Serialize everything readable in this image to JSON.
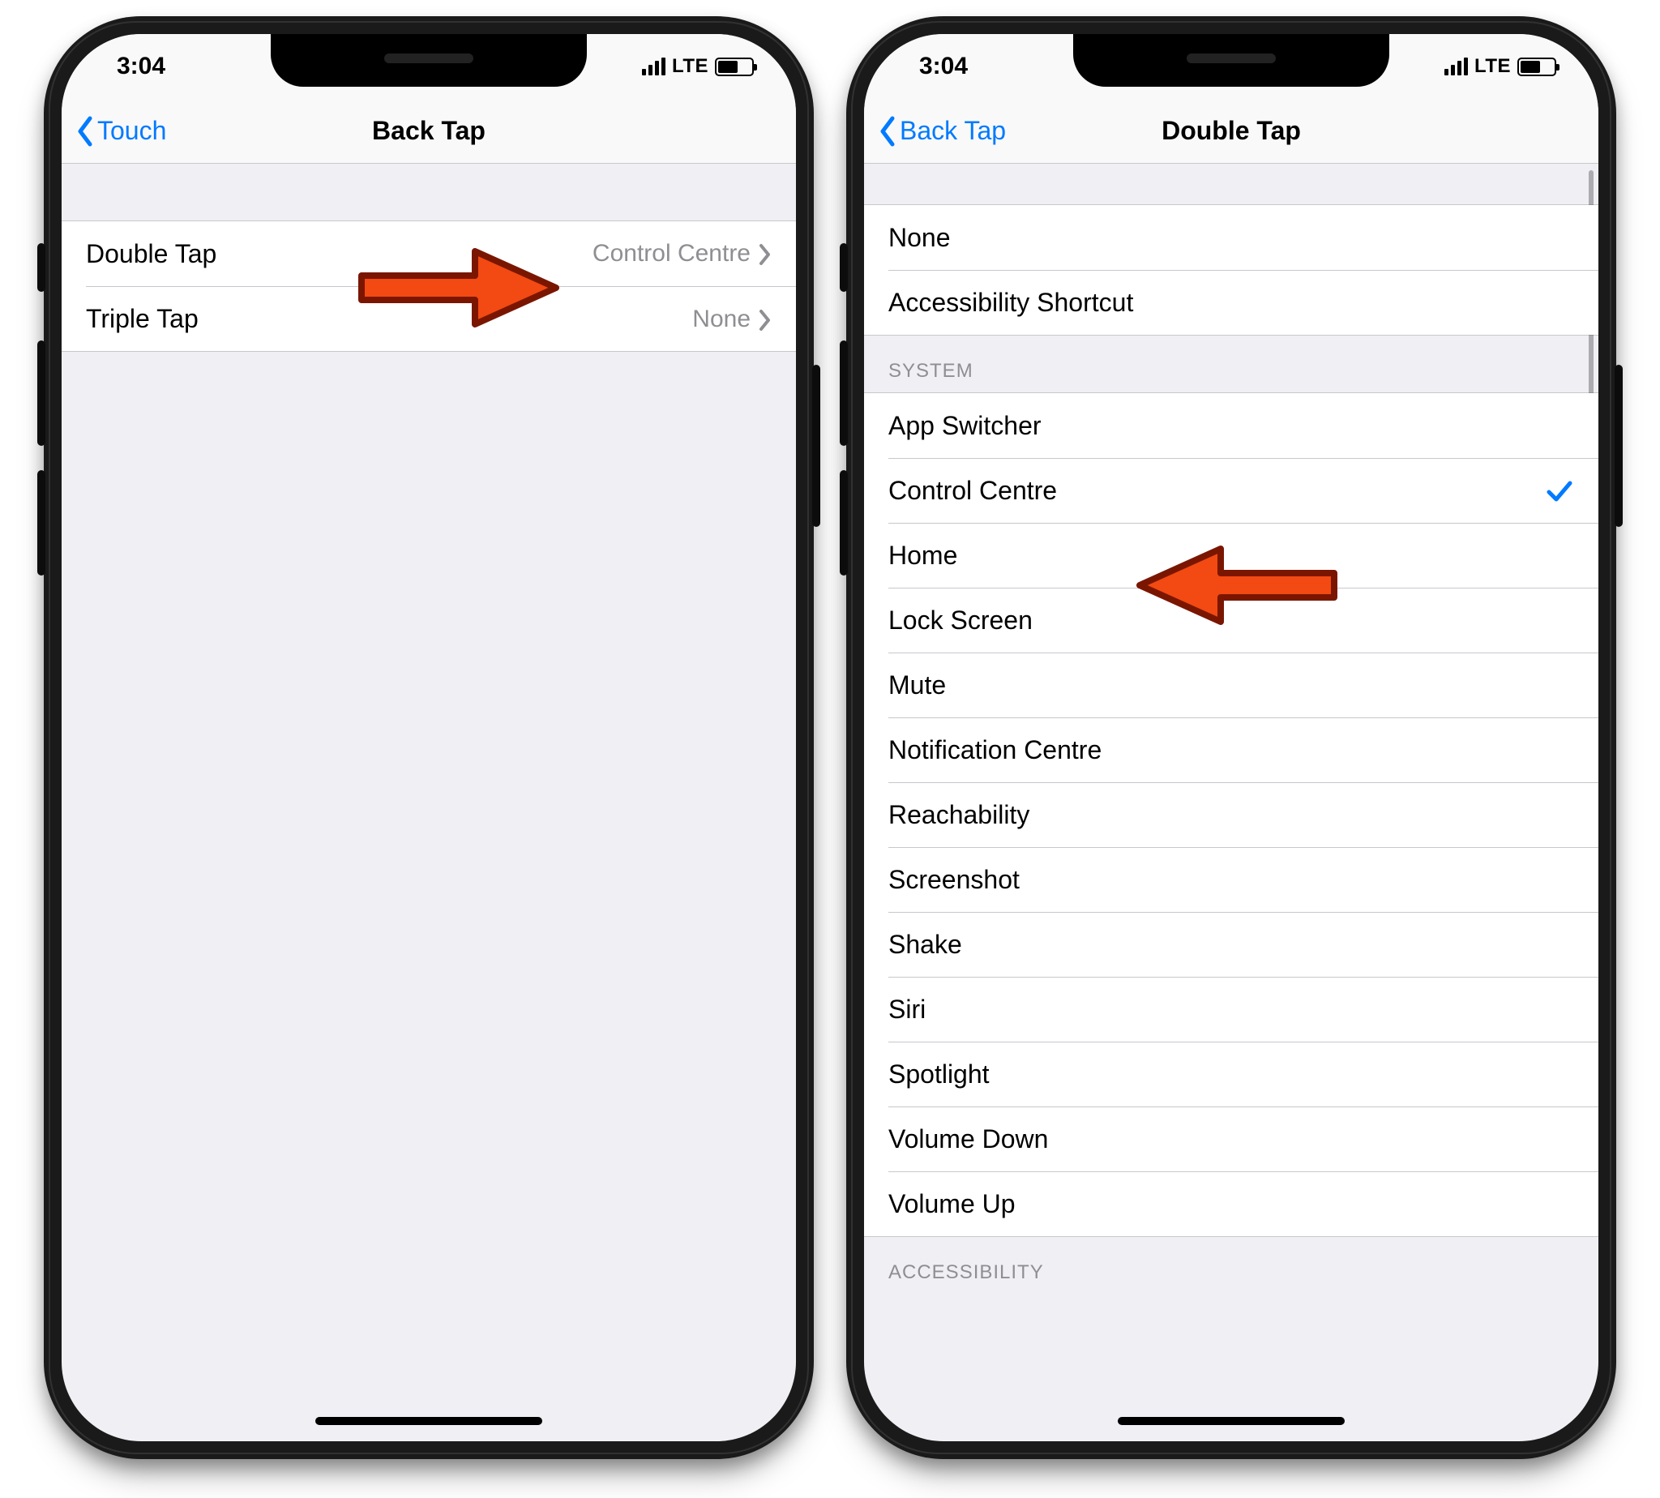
{
  "status": {
    "time": "3:04",
    "network_label": "LTE"
  },
  "phone_left": {
    "nav": {
      "back_label": "Touch",
      "title": "Back Tap"
    },
    "rows": {
      "double_tap_label": "Double Tap",
      "double_tap_value": "Control Centre",
      "triple_tap_label": "Triple Tap",
      "triple_tap_value": "None"
    }
  },
  "phone_right": {
    "nav": {
      "back_label": "Back Tap",
      "title": "Double Tap"
    },
    "top_rows": {
      "none": "None",
      "accessibility_shortcut": "Accessibility Shortcut"
    },
    "section_system_header": "SYSTEM",
    "system_rows": {
      "app_switcher": "App Switcher",
      "control_centre": "Control Centre",
      "home": "Home",
      "lock_screen": "Lock Screen",
      "mute": "Mute",
      "notification_centre": "Notification Centre",
      "reachability": "Reachability",
      "screenshot": "Screenshot",
      "shake": "Shake",
      "siri": "Siri",
      "spotlight": "Spotlight",
      "volume_down": "Volume Down",
      "volume_up": "Volume Up"
    },
    "selected_key": "control_centre",
    "section_accessibility_header": "ACCESSIBILITY"
  },
  "annotations": {
    "arrow_right": "red-arrow-right",
    "arrow_left": "red-arrow-left"
  }
}
